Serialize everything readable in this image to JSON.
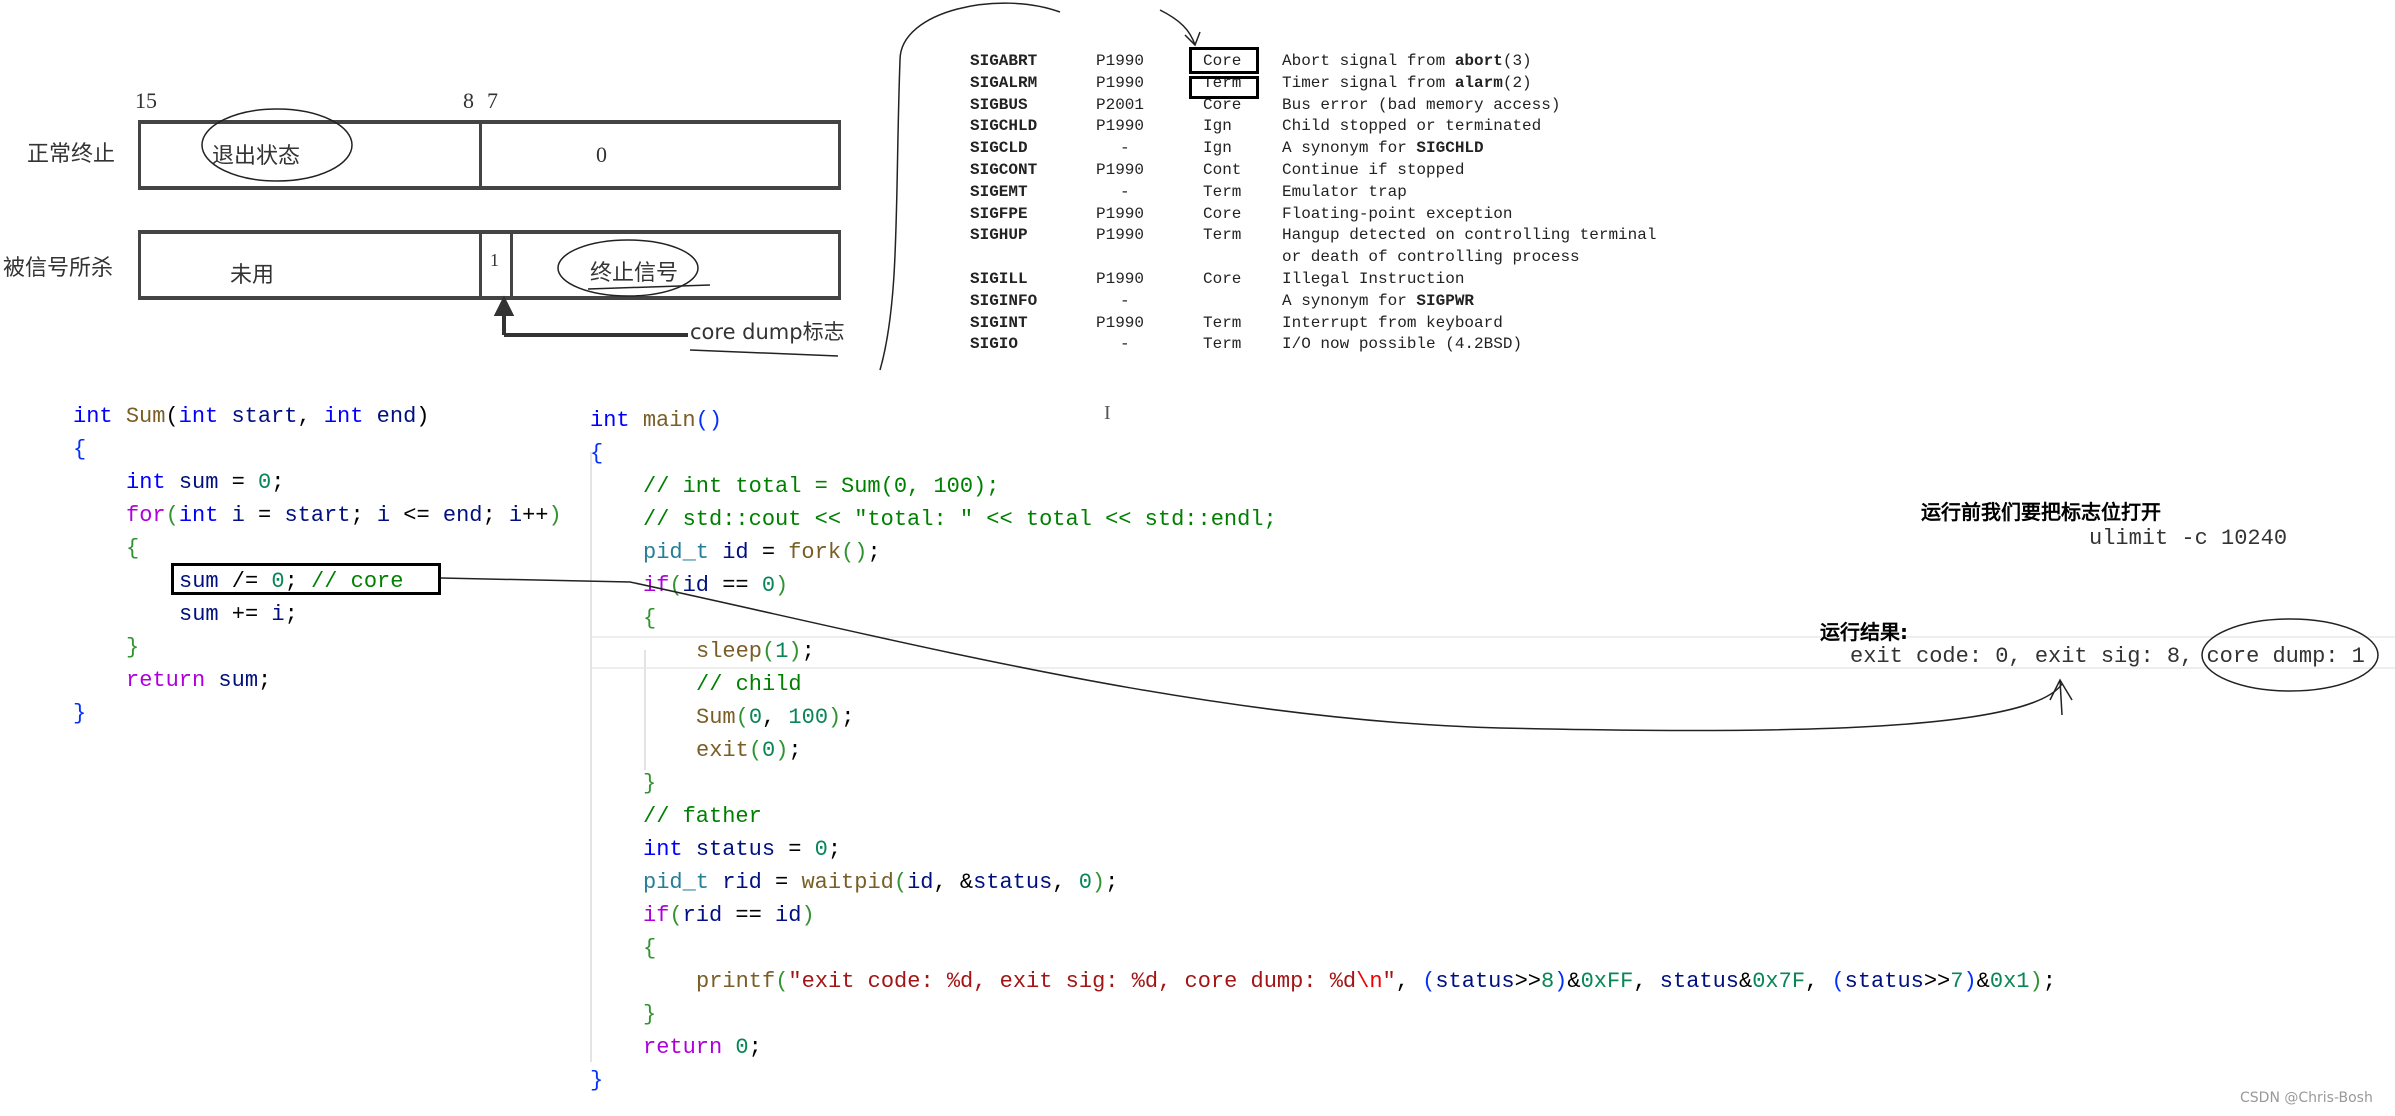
{
  "diagram": {
    "bit15": "15",
    "bit8": "8",
    "bit7": "7",
    "row1_label": "正常终止",
    "row1_high": "退出状态",
    "row1_low": "0",
    "row2_label": "被信号所杀",
    "row2_high": "未用",
    "row2_core": "1",
    "row2_low": "终止信号",
    "core_dump_label": "core dump标志"
  },
  "signals": [
    {
      "name": "SIGABRT",
      "std": "P1990",
      "action": "Core",
      "desc": "Abort signal from ",
      "bold": "abort",
      "tail": "(3)"
    },
    {
      "name": "SIGALRM",
      "std": "P1990",
      "action": "Term",
      "desc": "Timer signal from ",
      "bold": "alarm",
      "tail": "(2)"
    },
    {
      "name": "SIGBUS",
      "std": "P2001",
      "action": "Core",
      "desc": "Bus error (bad memory access)"
    },
    {
      "name": "SIGCHLD",
      "std": "P1990",
      "action": "Ign",
      "desc": "Child stopped or terminated"
    },
    {
      "name": "SIGCLD",
      "std": "-",
      "action": "Ign",
      "desc": "A synonym for ",
      "bold": "SIGCHLD"
    },
    {
      "name": "SIGCONT",
      "std": "P1990",
      "action": "Cont",
      "desc": "Continue if stopped"
    },
    {
      "name": "SIGEMT",
      "std": "-",
      "action": "Term",
      "desc": "Emulator trap"
    },
    {
      "name": "SIGFPE",
      "std": "P1990",
      "action": "Core",
      "desc": "Floating-point exception"
    },
    {
      "name": "SIGHUP",
      "std": "P1990",
      "action": "Term",
      "desc": "Hangup detected on controlling terminal"
    },
    {
      "name": "",
      "std": "",
      "action": "",
      "desc": "or death of controlling process"
    },
    {
      "name": "SIGILL",
      "std": "P1990",
      "action": "Core",
      "desc": "Illegal Instruction"
    },
    {
      "name": "SIGINFO",
      "std": "-",
      "action": "",
      "desc": "A synonym for ",
      "bold": "SIGPWR"
    },
    {
      "name": "SIGINT",
      "std": "P1990",
      "action": "Term",
      "desc": "Interrupt from keyboard"
    },
    {
      "name": "SIGIO",
      "std": "-",
      "action": "Term",
      "desc": "I/O now possible (4.2BSD)"
    }
  ],
  "sum_code": [
    {
      "i": 0,
      "t": [
        [
          "k",
          "int"
        ],
        [
          "",
          " "
        ],
        [
          "f",
          "Sum"
        ],
        [
          "",
          "("
        ],
        [
          "k",
          "int"
        ],
        [
          "",
          " "
        ],
        [
          "v",
          "start"
        ],
        [
          "",
          ", "
        ],
        [
          "k",
          "int"
        ],
        [
          "",
          " "
        ],
        [
          "v",
          "end"
        ],
        [
          "",
          ")"
        ]
      ]
    },
    {
      "i": 0,
      "t": [
        [
          "p",
          "{"
        ]
      ]
    },
    {
      "i": 1,
      "t": [
        [
          "k",
          "int"
        ],
        [
          "",
          " "
        ],
        [
          "v",
          "sum"
        ],
        [
          "",
          " = "
        ],
        [
          "n2",
          "0"
        ],
        [
          "",
          ";"
        ]
      ]
    },
    {
      "i": 1,
      "t": [
        [
          "c",
          "for"
        ],
        [
          "q",
          "("
        ],
        [
          "k",
          "int"
        ],
        [
          "",
          " "
        ],
        [
          "v",
          "i"
        ],
        [
          "",
          " = "
        ],
        [
          "v",
          "start"
        ],
        [
          "",
          "; "
        ],
        [
          "v",
          "i"
        ],
        [
          "",
          " <= "
        ],
        [
          "v",
          "end"
        ],
        [
          "",
          "; "
        ],
        [
          "v",
          "i"
        ],
        [
          "",
          "++"
        ],
        [
          "q",
          ")"
        ]
      ]
    },
    {
      "i": 1,
      "t": [
        [
          "q",
          "{"
        ]
      ]
    },
    {
      "i": 2,
      "t": [
        [
          "v",
          "sum"
        ],
        [
          "",
          " /= "
        ],
        [
          "n2",
          "0"
        ],
        [
          "",
          "; "
        ],
        [
          "m",
          "// core"
        ]
      ]
    },
    {
      "i": 2,
      "t": [
        [
          "v",
          "sum"
        ],
        [
          "",
          " += "
        ],
        [
          "v",
          "i"
        ],
        [
          "",
          ";"
        ]
      ]
    },
    {
      "i": 1,
      "t": [
        [
          "q",
          "}"
        ]
      ]
    },
    {
      "i": 1,
      "t": [
        [
          "c",
          "return"
        ],
        [
          "",
          " "
        ],
        [
          "v",
          "sum"
        ],
        [
          "",
          ";"
        ]
      ]
    },
    {
      "i": 0,
      "t": [
        [
          "p",
          "}"
        ]
      ]
    }
  ],
  "main_code": [
    {
      "i": 0,
      "t": [
        [
          "k",
          "int"
        ],
        [
          "",
          " "
        ],
        [
          "f",
          "main"
        ],
        [
          "p",
          "()"
        ]
      ]
    },
    {
      "i": 0,
      "t": [
        [
          "p",
          "{"
        ]
      ]
    },
    {
      "i": 1,
      "t": [
        [
          "m",
          "// int total = Sum(0, 100);"
        ]
      ]
    },
    {
      "i": 1,
      "t": [
        [
          "m",
          "// std::cout << \"total: \" << total << std::endl;"
        ]
      ]
    },
    {
      "i": 1,
      "t": [
        [
          "t",
          "pid_t"
        ],
        [
          "",
          " "
        ],
        [
          "v",
          "id"
        ],
        [
          "",
          " = "
        ],
        [
          "f",
          "fork"
        ],
        [
          "q",
          "()"
        ],
        [
          "",
          ";"
        ]
      ]
    },
    {
      "i": 1,
      "t": [
        [
          "c",
          "if"
        ],
        [
          "q",
          "("
        ],
        [
          "v",
          "id"
        ],
        [
          "",
          " == "
        ],
        [
          "n2",
          "0"
        ],
        [
          "q",
          ")"
        ]
      ]
    },
    {
      "i": 1,
      "t": [
        [
          "q",
          "{"
        ]
      ]
    },
    {
      "i": 2,
      "t": [
        [
          "f",
          "sleep"
        ],
        [
          "q",
          "("
        ],
        [
          "n2",
          "1"
        ],
        [
          "q",
          ")"
        ],
        [
          "",
          ";"
        ]
      ]
    },
    {
      "i": 2,
      "t": [
        [
          "m",
          "// child"
        ]
      ]
    },
    {
      "i": 2,
      "t": [
        [
          "f",
          "Sum"
        ],
        [
          "q",
          "("
        ],
        [
          "n2",
          "0"
        ],
        [
          "",
          ", "
        ],
        [
          "n2",
          "100"
        ],
        [
          "q",
          ")"
        ],
        [
          "",
          ";"
        ]
      ]
    },
    {
      "i": 2,
      "t": [
        [
          "f",
          "exit"
        ],
        [
          "q",
          "("
        ],
        [
          "n2",
          "0"
        ],
        [
          "q",
          ")"
        ],
        [
          "",
          ";"
        ]
      ]
    },
    {
      "i": 1,
      "t": [
        [
          "q",
          "}"
        ]
      ]
    },
    {
      "i": 1,
      "t": [
        [
          "m",
          "// father"
        ]
      ]
    },
    {
      "i": 1,
      "t": [
        [
          "k",
          "int"
        ],
        [
          "",
          " "
        ],
        [
          "v",
          "status"
        ],
        [
          "",
          " = "
        ],
        [
          "n2",
          "0"
        ],
        [
          "",
          ";"
        ]
      ]
    },
    {
      "i": 1,
      "t": [
        [
          "t",
          "pid_t"
        ],
        [
          "",
          " "
        ],
        [
          "v",
          "rid"
        ],
        [
          "",
          " = "
        ],
        [
          "f",
          "waitpid"
        ],
        [
          "q",
          "("
        ],
        [
          "v",
          "id"
        ],
        [
          "",
          ", &"
        ],
        [
          "v",
          "status"
        ],
        [
          "",
          ", "
        ],
        [
          "n2",
          "0"
        ],
        [
          "q",
          ")"
        ],
        [
          "",
          ";"
        ]
      ]
    },
    {
      "i": 1,
      "t": [
        [
          "c",
          "if"
        ],
        [
          "q",
          "("
        ],
        [
          "v",
          "rid"
        ],
        [
          "",
          " == "
        ],
        [
          "v",
          "id"
        ],
        [
          "q",
          ")"
        ]
      ]
    },
    {
      "i": 1,
      "t": [
        [
          "q",
          "{"
        ]
      ]
    },
    {
      "i": 2,
      "t": [
        [
          "f",
          "printf"
        ],
        [
          "q",
          "("
        ],
        [
          "s",
          "\"exit code: %d, exit sig: %d, core dump: %d"
        ],
        [
          "e",
          "\\n"
        ],
        [
          "s",
          "\""
        ],
        [
          "",
          ", "
        ],
        [
          "p",
          "("
        ],
        [
          "v",
          "status"
        ],
        [
          "",
          ">>"
        ],
        [
          "n2",
          "8"
        ],
        [
          "p",
          ")"
        ],
        [
          "",
          "&"
        ],
        [
          "n2",
          "0xFF"
        ],
        [
          "",
          ", "
        ],
        [
          "v",
          "status"
        ],
        [
          "",
          "&"
        ],
        [
          "n2",
          "0x7F"
        ],
        [
          "",
          ", "
        ],
        [
          "p",
          "("
        ],
        [
          "v",
          "status"
        ],
        [
          "",
          ">>"
        ],
        [
          "n2",
          "7"
        ],
        [
          "p",
          ")"
        ],
        [
          "",
          "&"
        ],
        [
          "n2",
          "0x1"
        ],
        [
          "q",
          ")"
        ],
        [
          "",
          ";"
        ]
      ]
    },
    {
      "i": 1,
      "t": [
        [
          "q",
          "}"
        ]
      ]
    },
    {
      "i": 1,
      "t": [
        [
          "c",
          "return"
        ],
        [
          "",
          " "
        ],
        [
          "n2",
          "0"
        ],
        [
          "",
          ";"
        ]
      ]
    },
    {
      "i": 0,
      "t": [
        [
          "p",
          "}"
        ]
      ]
    }
  ],
  "notes": {
    "before_run": "运行前我们要把标志位打开",
    "ulimit_cmd": "ulimit -c 10240",
    "result_label": "运行结果:",
    "result_output": "exit code: 0, exit sig: 8, core dump: 1"
  },
  "watermark": "CSDN @Chris-Bosh"
}
